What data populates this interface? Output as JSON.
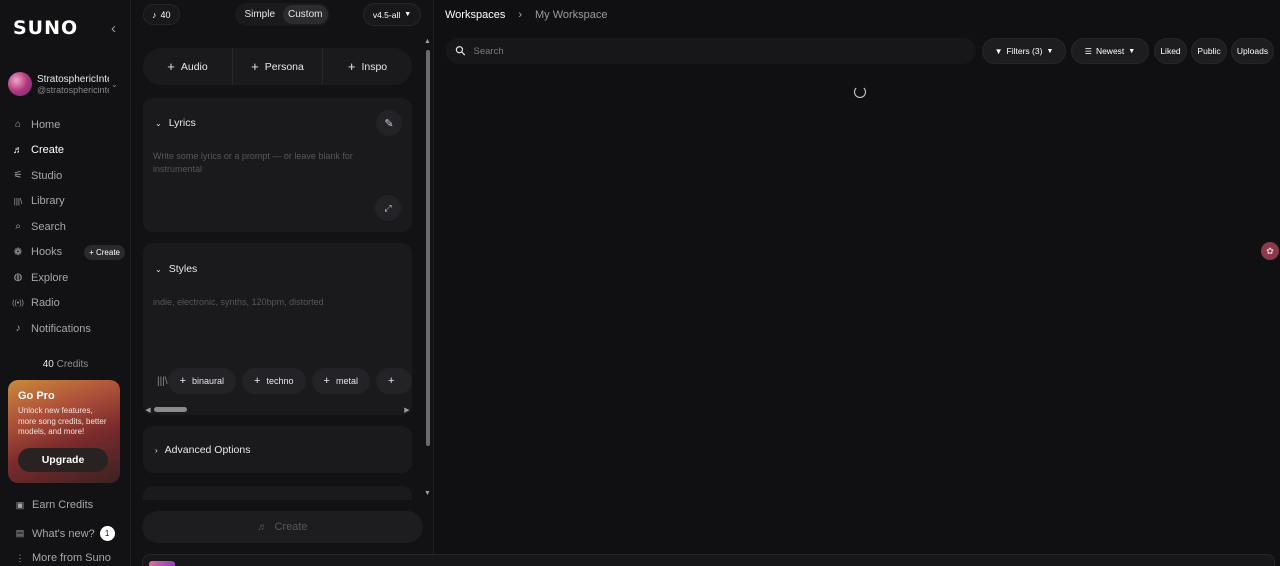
{
  "sidebar": {
    "logo": "SUNO",
    "collapse_icon": "‹",
    "profile": {
      "name": "StratosphericInte",
      "handle": "@stratosphericinte"
    },
    "nav": [
      {
        "label": "Home",
        "icon": "home-icon",
        "glyph": "⌂"
      },
      {
        "label": "Create",
        "icon": "music-note-icon",
        "glyph": "♬"
      },
      {
        "label": "Studio",
        "icon": "studio-icon",
        "glyph": "⚟"
      },
      {
        "label": "Library",
        "icon": "library-icon",
        "glyph": "|||\\"
      },
      {
        "label": "Search",
        "icon": "search-icon",
        "glyph": "⌕"
      },
      {
        "label": "Hooks",
        "icon": "hooks-icon",
        "glyph": "❁"
      },
      {
        "label": "Explore",
        "icon": "explore-icon",
        "glyph": "◍"
      },
      {
        "label": "Radio",
        "icon": "radio-icon",
        "glyph": "((•))"
      },
      {
        "label": "Notifications",
        "icon": "bell-icon",
        "glyph": "♪"
      }
    ],
    "hooks_badge": "+ Create",
    "credits_value": "40",
    "credits_label": "Credits",
    "gopro": {
      "title": "Go Pro",
      "desc": "Unlock new features, more song credits, better models, and more!",
      "upgrade": "Upgrade"
    },
    "earn_credits": "Earn Credits",
    "whats_new": "What's new?",
    "whats_new_count": "1",
    "more_from": "More from Suno"
  },
  "create_panel": {
    "credit_count": "40",
    "mode_simple": "Simple",
    "mode_custom": "Custom",
    "model": "v4.5-all",
    "add_buttons": [
      "Audio",
      "Persona",
      "Inspo"
    ],
    "lyrics": {
      "title": "Lyrics",
      "placeholder": "Write some lyrics or a prompt — or leave blank for instrumental"
    },
    "styles": {
      "title": "Styles",
      "placeholder": "indie, electronic, synths, 120bpm, distorted",
      "tags": [
        "binaural",
        "techno",
        "metal",
        ""
      ]
    },
    "advanced": "Advanced Options",
    "create_label": "Create"
  },
  "main": {
    "breadcrumb_root": "Workspaces",
    "breadcrumb_current": "My Workspace",
    "search_placeholder": "Search",
    "filters": "Filters (3)",
    "sort": "Newest",
    "liked": "Liked",
    "public": "Public",
    "uploads": "Uploads"
  },
  "colors": {
    "background": "#101012",
    "panel": "#1a1a1d",
    "gopro_gradient_start": "#c98a3a",
    "gopro_gradient_end": "#3a2221"
  }
}
